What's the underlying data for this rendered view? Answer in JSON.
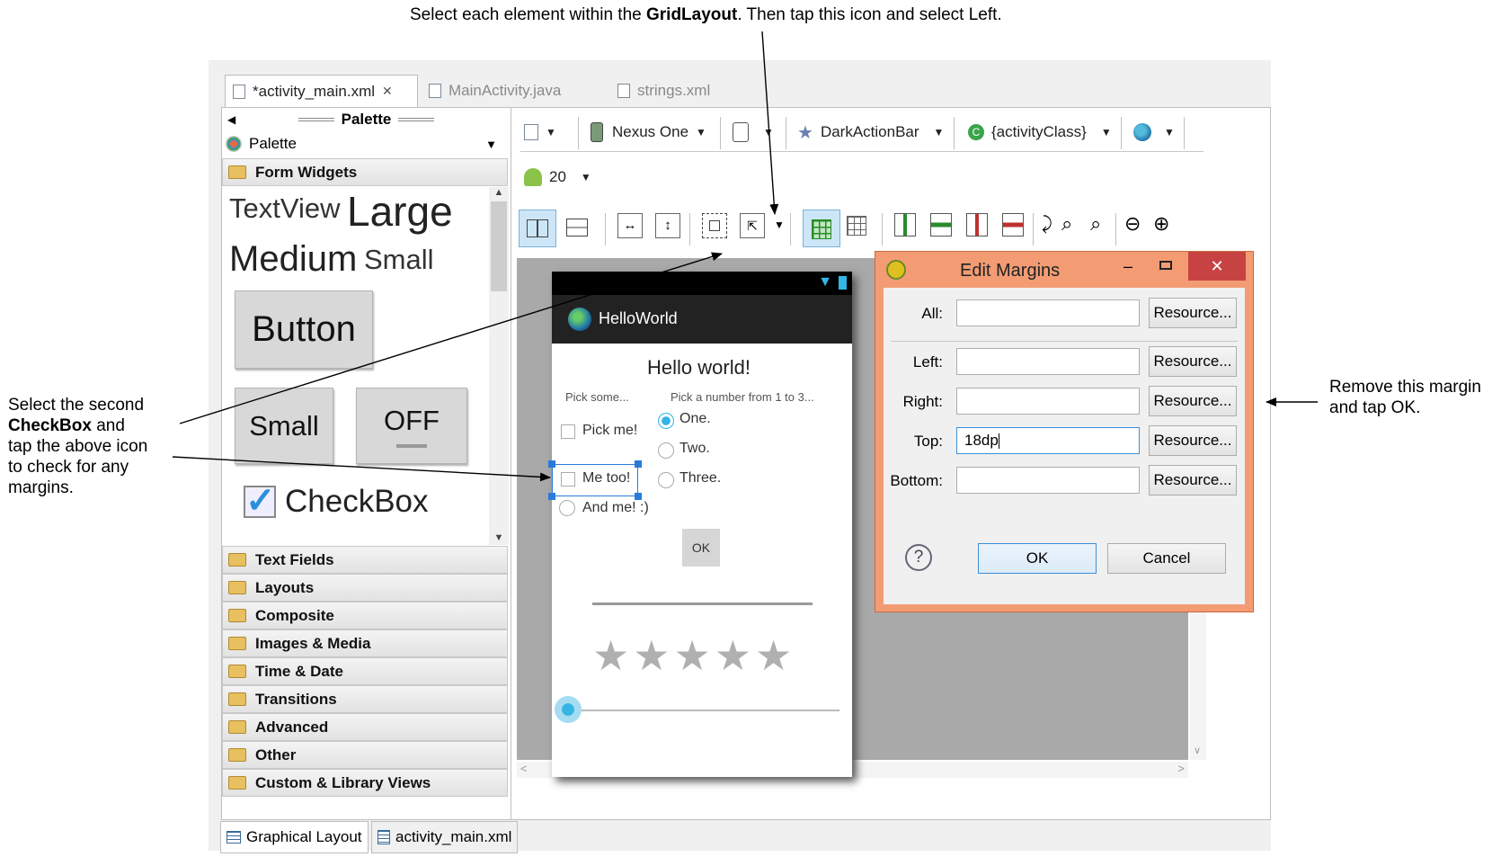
{
  "annotations": {
    "top_prefix": "Select each element within the ",
    "top_bold": "GridLayout",
    "top_suffix": ". Then tap this icon and select Left.",
    "left_line1": "Select the second",
    "left_bold": "CheckBox",
    "left_line2_suffix": " and",
    "left_line3": "tap the above icon",
    "left_line4": "to check for any",
    "left_line5": "margins.",
    "right_line1": "Remove this margin",
    "right_line2": "and tap OK."
  },
  "editor_tabs": [
    "*activity_main.xml",
    "MainActivity.java",
    "strings.xml"
  ],
  "palette": {
    "header": "Palette",
    "dropdown_label": "Palette",
    "open_category": "Form Widgets",
    "widgets": {
      "textview": "TextView",
      "large": "Large",
      "medium": "Medium",
      "small": "Small",
      "button": "Button",
      "small_button": "Small",
      "toggle": "OFF",
      "checkbox": "CheckBox"
    },
    "categories": [
      "Text Fields",
      "Layouts",
      "Composite",
      "Images & Media",
      "Time & Date",
      "Transitions",
      "Advanced",
      "Other",
      "Custom & Library Views"
    ]
  },
  "toolbar": {
    "device": "Nexus One",
    "theme": "DarkActionBar",
    "activity": "{activityClass}",
    "api_level": "20"
  },
  "device_preview": {
    "app_title": "HelloWorld",
    "heading": "Hello world!",
    "col1_label": "Pick some...",
    "col2_label": "Pick a number from 1 to 3...",
    "checkboxes": [
      "Pick me!",
      "Me too!",
      "And me! :)"
    ],
    "radios": [
      "One.",
      "Two.",
      "Three."
    ],
    "ok_button": "OK",
    "rating_stars": 5
  },
  "dialog": {
    "title": "Edit Margins",
    "fields": [
      {
        "label": "All:",
        "value": "",
        "button": "Resource..."
      },
      {
        "label": "Left:",
        "value": "",
        "button": "Resource..."
      },
      {
        "label": "Right:",
        "value": "",
        "button": "Resource..."
      },
      {
        "label": "Top:",
        "value": "18dp",
        "button": "Resource..."
      },
      {
        "label": "Bottom:",
        "value": "",
        "button": "Resource..."
      }
    ],
    "ok": "OK",
    "cancel": "Cancel",
    "accent_color": "#f39c74",
    "close_color": "#c74343"
  },
  "bottom_tabs": [
    "Graphical Layout",
    "activity_main.xml"
  ]
}
